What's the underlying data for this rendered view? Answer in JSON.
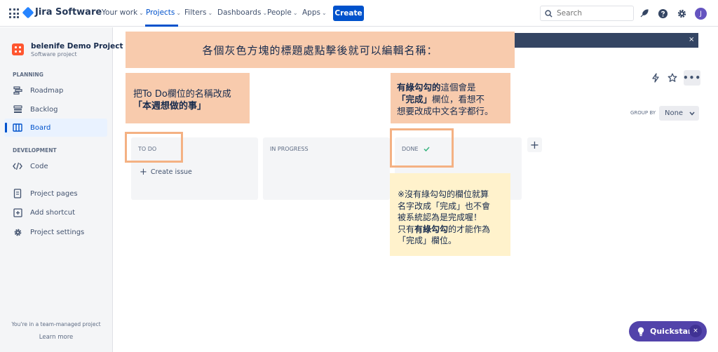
{
  "topnav": {
    "logo": "Jira Software",
    "items": [
      {
        "label": "Your work"
      },
      {
        "label": "Projects"
      },
      {
        "label": "Filters"
      },
      {
        "label": "Dashboards"
      },
      {
        "label": "People"
      },
      {
        "label": "Apps"
      }
    ],
    "create_label": "Create",
    "search_placeholder": "Search",
    "avatar_initial": "J"
  },
  "sidebar": {
    "project_name": "belenife Demo Project",
    "project_type": "Software project",
    "planning_heading": "PLANNING",
    "planning_items": [
      {
        "label": "Roadmap",
        "icon": "roadmap-icon"
      },
      {
        "label": "Backlog",
        "icon": "backlog-icon"
      },
      {
        "label": "Board",
        "icon": "board-icon"
      }
    ],
    "development_heading": "DEVELOPMENT",
    "development_items": [
      {
        "label": "Code",
        "icon": "code-icon"
      }
    ],
    "other_items": [
      {
        "label": "Project pages",
        "icon": "page-icon"
      },
      {
        "label": "Add shortcut",
        "icon": "add-shortcut-icon"
      },
      {
        "label": "Project settings",
        "icon": "gear-icon"
      }
    ],
    "footer_text": "You're in a team-managed project",
    "footer_link": "Learn more"
  },
  "board": {
    "banner_close": "×",
    "group_by_label": "GROUP BY",
    "group_by_value": "None",
    "columns": [
      {
        "title": "TO DO"
      },
      {
        "title": "IN PROGRESS"
      },
      {
        "title": "DONE"
      }
    ],
    "create_issue": "Create issue"
  },
  "annotations": {
    "top": "各個灰色方塊的標題處點擊後就可以編輯名稱：",
    "todo_line1": "把To Do欄位的名稱改成",
    "todo_line2": "「本週想做的事」",
    "done_bold1": "有綠勾勾的",
    "done_rest1": "這個會是",
    "done_bold2": "「完成」",
    "done_rest2": "欄位，看想不",
    "done_line3": "想要改成中文名字都行。",
    "note_line1": "※沒有綠勾勾的欄位就算",
    "note_line2": "名字改成「完成」也不會",
    "note_line3": "被系統認為是完成喔！",
    "note_pre4": "只有",
    "note_bold4": "有綠勾勾",
    "note_rest4": "的才能作為",
    "note_line5": "「完成」欄位。"
  },
  "quickstart": {
    "label": "Quickstart",
    "close": "×"
  },
  "colors": {
    "brand": "#0052cc",
    "annotation_orange": "#f8cbad",
    "annotation_yellow": "#fff2cc",
    "frame": "#f4b183",
    "quickstart": "#5243aa",
    "done_check": "#36b37e"
  }
}
